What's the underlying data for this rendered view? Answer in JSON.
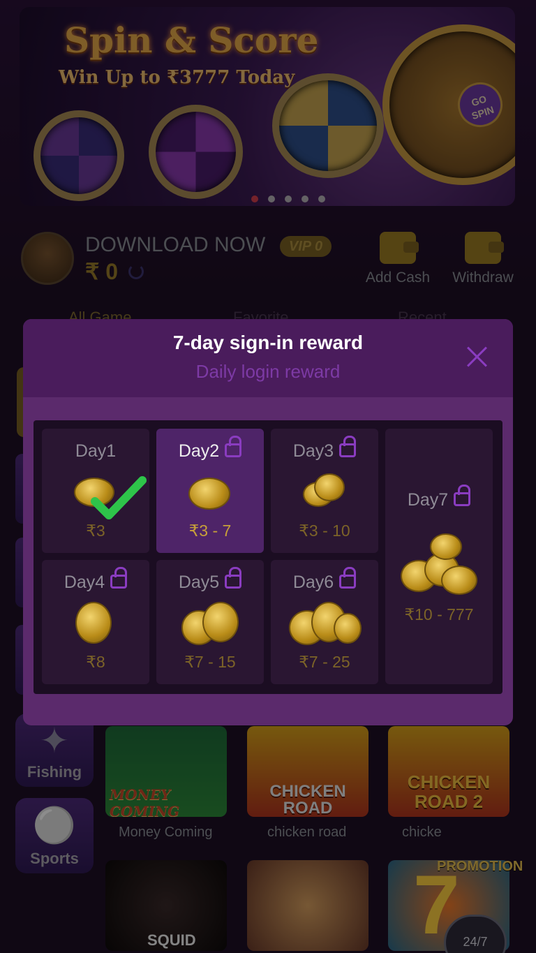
{
  "banner": {
    "title": "Spin & Score",
    "subtitle": "Win Up to ₹3777 Today",
    "spin_button": "GO SPIN",
    "slides": 5,
    "active_slide": 1
  },
  "user": {
    "name": "DOWNLOAD NOW",
    "vip": "VIP 0",
    "balance": "₹ 0"
  },
  "actions": {
    "add_cash": "Add Cash",
    "withdraw": "Withdraw"
  },
  "tabs": [
    "All Game",
    "Favorite",
    "Recent"
  ],
  "side_nav": [
    {
      "label": "Fishing",
      "icon": "fish-icon"
    },
    {
      "label": "Sports",
      "icon": "cricket-icon"
    }
  ],
  "games": {
    "row1": [
      {
        "label": "Money Coming",
        "art": "MONEY COMING"
      },
      {
        "label": "chicken road",
        "art": "CHICKEN ROAD"
      },
      {
        "label": "chicke",
        "art": "CHICKEN ROAD 2"
      }
    ],
    "row2": [
      "SQUID",
      "",
      ""
    ],
    "promotion": "PROMOTION",
    "support": "24/7"
  },
  "modal": {
    "title": "7-day sign-in reward",
    "subtitle": "Daily login reward",
    "days": [
      {
        "day": "Day1",
        "amount": "₹3",
        "state": "claimed"
      },
      {
        "day": "Day2",
        "amount": "₹3 - 7",
        "state": "current"
      },
      {
        "day": "Day3",
        "amount": "₹3 - 10",
        "state": "locked"
      },
      {
        "day": "Day4",
        "amount": "₹8",
        "state": "locked"
      },
      {
        "day": "Day5",
        "amount": "₹7 - 15",
        "state": "locked"
      },
      {
        "day": "Day6",
        "amount": "₹7 - 25",
        "state": "locked"
      },
      {
        "day": "Day7",
        "amount": "₹10 - 777",
        "state": "locked"
      }
    ]
  },
  "colors": {
    "accent": "#8a3cc0",
    "gold": "#c7a03a",
    "modal_bg": "#5b2a6c"
  }
}
